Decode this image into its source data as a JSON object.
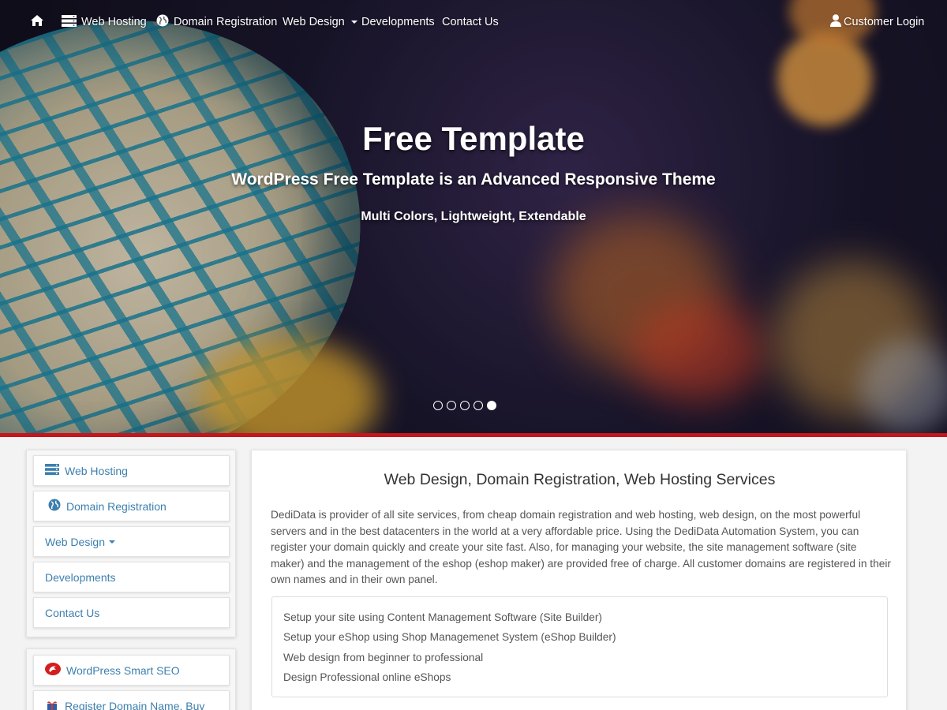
{
  "nav": {
    "home_icon": "home-icon",
    "items": [
      {
        "label": "Web Hosting",
        "icon": "server-icon"
      },
      {
        "label": "Domain Registration",
        "icon": "globe-icon"
      },
      {
        "label": "Web Design",
        "icon": "caret-down-icon"
      },
      {
        "label": "Developments"
      },
      {
        "label": "Contact Us"
      }
    ],
    "login": {
      "label": "Customer Login",
      "icon": "user-icon"
    }
  },
  "hero": {
    "title": "Free Template",
    "subtitle": "WordPress Free Template is an Advanced Responsive Theme",
    "tagline": "Multi Colors, Lightweight, Extendable",
    "slides_total": 5,
    "active_slide": 5
  },
  "sidebar": {
    "menu": [
      {
        "label": "Web Hosting",
        "icon": "server-icon"
      },
      {
        "label": "Domain Registration",
        "icon": "globe-icon"
      },
      {
        "label": "Web Design",
        "icon": "caret-down-icon"
      },
      {
        "label": "Developments"
      },
      {
        "label": "Contact Us"
      }
    ],
    "links": [
      {
        "label": "WordPress Smart SEO",
        "icon": "seo-badge-icon"
      },
      {
        "label": "Register Domain Name, Buy",
        "icon": "domain-gift-icon"
      }
    ]
  },
  "main": {
    "title": "Web Design, Domain Registration, Web Hosting Services",
    "body": "DediData is provider of all site services, from cheap domain registration and web hosting, web design, on the most powerful servers and in the best datacenters in the world at a very affordable price. Using the DediData Automation System, you can register your domain quickly and create your site fast. Also, for managing your website, the site management software (site maker) and the management of the eshop (eshop maker) are provided free of charge. All customer domains are registered in their own names and in their own panel.",
    "features": [
      "Setup your site using Content Management Software (Site Builder)",
      "Setup your eShop using Shop Managemenet System (eShop Builder)",
      "Web design from beginner to professional",
      "Design Professional online eShops"
    ]
  },
  "colors": {
    "accent_red": "#c4161c",
    "link_blue": "#3d7fae",
    "hero_dark": "#1c1830"
  }
}
